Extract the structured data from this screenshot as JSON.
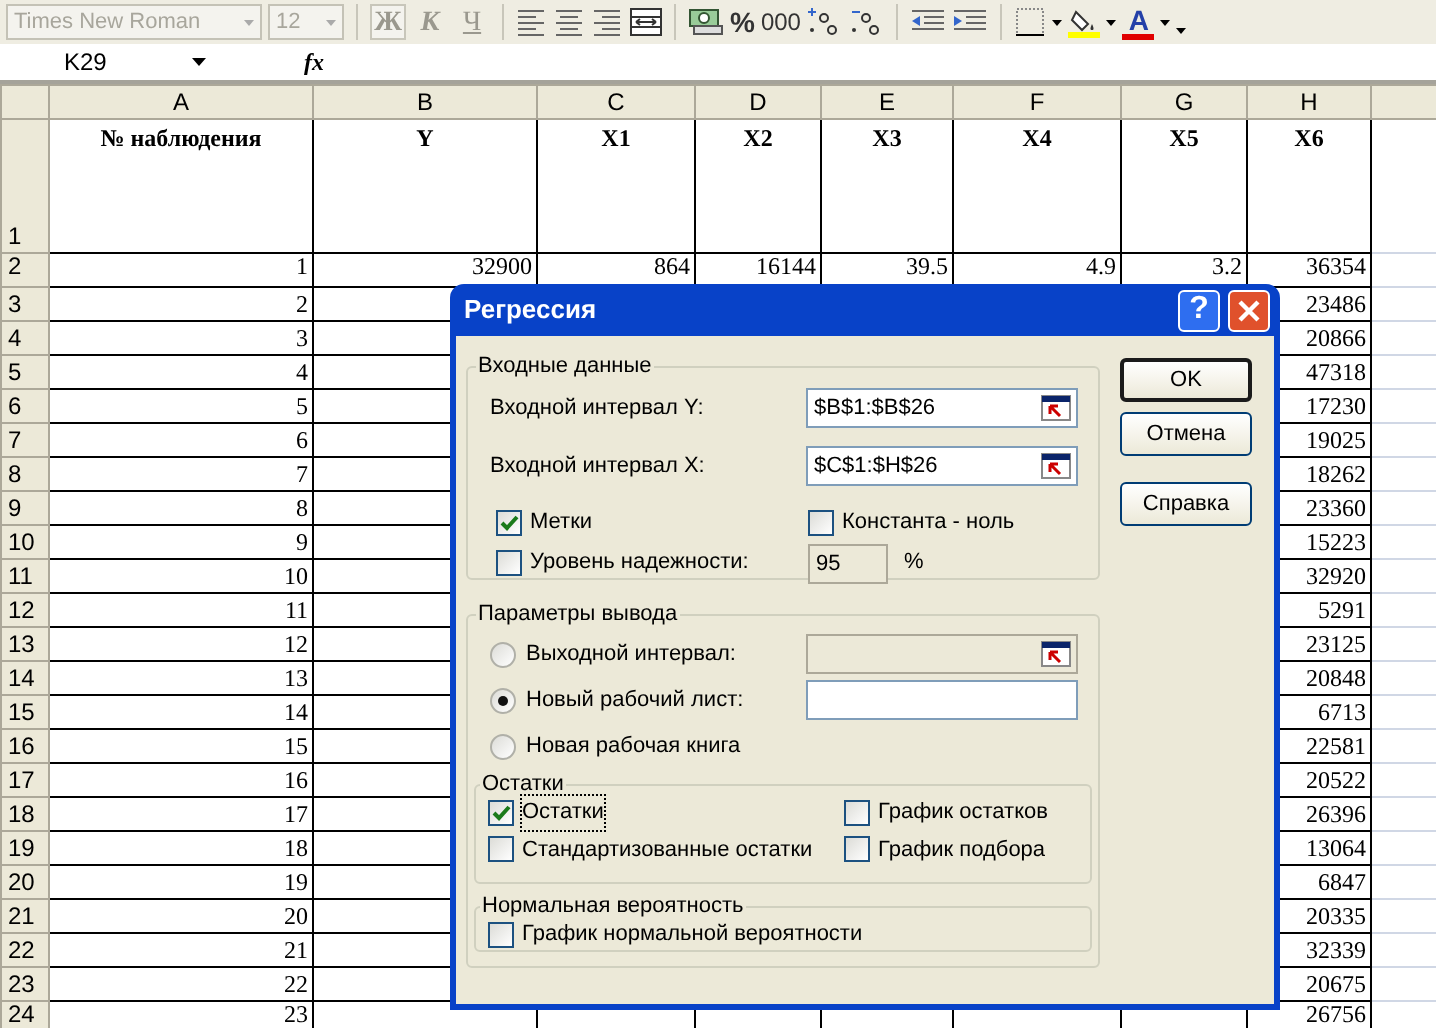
{
  "toolbar": {
    "font": "Times New Roman",
    "size": "12",
    "bold": "Ж",
    "italic": "К",
    "underline": "Ч",
    "percent": "%",
    "thousands": "000",
    "font_color_letter": "A"
  },
  "formula_bar": {
    "name_box": "K29",
    "fx": "fx"
  },
  "sheet": {
    "columns": [
      "A",
      "B",
      "C",
      "D",
      "E",
      "F",
      "G",
      "H"
    ],
    "rows": [
      {
        "n": "1",
        "cells": {
          "A": "№ наблюдения",
          "B": "Y",
          "C": "X1",
          "D": "X2",
          "E": "X3",
          "F": "X4",
          "G": "X5",
          "H": "X6"
        }
      },
      {
        "n": "2",
        "cells": {
          "A": "1",
          "B": "32900",
          "C": "864",
          "D": "16144",
          "E": "39.5",
          "F": "4.9",
          "G": "3.2",
          "H": "36354"
        }
      },
      {
        "n": "3",
        "cells": {
          "A": "2",
          "H": "23486"
        }
      },
      {
        "n": "4",
        "cells": {
          "A": "3",
          "H": "20866"
        }
      },
      {
        "n": "5",
        "cells": {
          "A": "4",
          "H": "47318"
        }
      },
      {
        "n": "6",
        "cells": {
          "A": "5",
          "H": "17230"
        }
      },
      {
        "n": "7",
        "cells": {
          "A": "6",
          "H": "19025"
        }
      },
      {
        "n": "8",
        "cells": {
          "A": "7",
          "H": "18262"
        }
      },
      {
        "n": "9",
        "cells": {
          "A": "8",
          "H": "23360"
        }
      },
      {
        "n": "10",
        "cells": {
          "A": "9",
          "H": "15223"
        }
      },
      {
        "n": "11",
        "cells": {
          "A": "10",
          "H": "32920"
        }
      },
      {
        "n": "12",
        "cells": {
          "A": "11",
          "H": "5291"
        }
      },
      {
        "n": "13",
        "cells": {
          "A": "12",
          "H": "23125"
        }
      },
      {
        "n": "14",
        "cells": {
          "A": "13",
          "H": "20848"
        }
      },
      {
        "n": "15",
        "cells": {
          "A": "14",
          "H": "6713"
        }
      },
      {
        "n": "16",
        "cells": {
          "A": "15",
          "H": "22581"
        }
      },
      {
        "n": "17",
        "cells": {
          "A": "16",
          "H": "20522"
        }
      },
      {
        "n": "18",
        "cells": {
          "A": "17",
          "H": "26396"
        }
      },
      {
        "n": "19",
        "cells": {
          "A": "18",
          "H": "13064"
        }
      },
      {
        "n": "20",
        "cells": {
          "A": "19",
          "H": "6847"
        }
      },
      {
        "n": "21",
        "cells": {
          "A": "20",
          "H": "20335"
        }
      },
      {
        "n": "22",
        "cells": {
          "A": "21",
          "H": "32339"
        }
      },
      {
        "n": "23",
        "cells": {
          "A": "22",
          "H": "20675"
        }
      },
      {
        "n": "24",
        "cells": {
          "A": "23",
          "H": "26756"
        }
      }
    ]
  },
  "dialog": {
    "title": "Регрессия",
    "help": "?",
    "input": {
      "title": "Входные данные",
      "ranges": [
        {
          "label": "Входной интервал Y:",
          "value": "$B$1:$B$26"
        },
        {
          "label": "Входной интервал X:",
          "value": "$C$1:$H$26"
        }
      ],
      "options": [
        {
          "label": "Метки",
          "checked": true
        },
        {
          "label": "Константа - ноль",
          "checked": false
        }
      ],
      "confidence": {
        "label": "Уровень надежности:",
        "checked": false,
        "value": "95",
        "unit": "%"
      }
    },
    "output": {
      "title": "Параметры вывода",
      "targets": [
        {
          "label": "Выходной интервал:",
          "selected": false,
          "kind": "range",
          "disabled": true
        },
        {
          "label": "Новый рабочий лист:",
          "selected": true,
          "kind": "text",
          "disabled": false
        },
        {
          "label": "Новая рабочая книга",
          "selected": false,
          "kind": "none"
        }
      ]
    },
    "residuals": {
      "title": "Остатки",
      "options": [
        {
          "label": "Остатки",
          "checked": true,
          "focused": true
        },
        {
          "label": "График остатков",
          "checked": false,
          "focused": false
        },
        {
          "label": "Стандартизованные остатки",
          "checked": false,
          "focused": false
        },
        {
          "label": "График подбора",
          "checked": false,
          "focused": false
        }
      ]
    },
    "normal": {
      "title": "Нормальная вероятность",
      "options": [
        {
          "label": "График нормальной вероятности",
          "checked": false,
          "focused": false
        }
      ]
    },
    "buttons": [
      {
        "label": "OK",
        "default": true
      },
      {
        "label": "Отмена",
        "default": false
      },
      {
        "label": "Справка",
        "default": false
      }
    ]
  }
}
